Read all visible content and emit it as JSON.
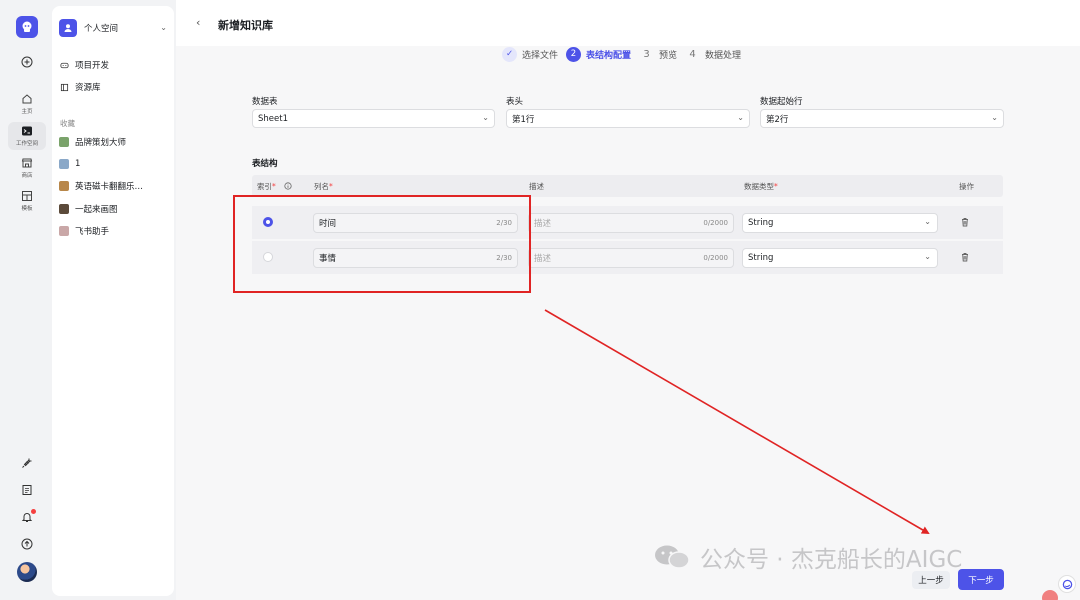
{
  "sidebar": {
    "rail": [
      {
        "label": "主页",
        "icon": "home-icon"
      },
      {
        "label": "工作空间",
        "icon": "terminal-icon"
      },
      {
        "label": "商店",
        "icon": "store-icon"
      },
      {
        "label": "模板",
        "icon": "template-icon"
      }
    ],
    "space_name": "个人空间",
    "items": [
      {
        "label": "项目开发",
        "icon": "gamepad-icon"
      },
      {
        "label": "资源库",
        "icon": "library-icon"
      }
    ],
    "favorites_title": "收藏",
    "favorites": [
      {
        "label": "品牌策划大师",
        "color": "#7aa36b"
      },
      {
        "label": "1",
        "color": "#8aa8c8"
      },
      {
        "label": "英语磁卡翻翻乐…",
        "color": "#b8874a"
      },
      {
        "label": "一起来画图",
        "color": "#5b4a3a"
      },
      {
        "label": "飞书助手",
        "color": "#c9a7a7"
      }
    ]
  },
  "header": {
    "back": "‹",
    "title": "新增知识库"
  },
  "steps": [
    {
      "num": "✓",
      "label": "选择文件",
      "state": "done"
    },
    {
      "num": "2",
      "label": "表结构配置",
      "state": "current"
    },
    {
      "num": "3",
      "label": "预览",
      "state": "todo"
    },
    {
      "num": "4",
      "label": "数据处理",
      "state": "todo"
    }
  ],
  "form": {
    "sheet_label": "数据表",
    "sheet_value": "Sheet1",
    "header_label": "表头",
    "header_value": "第1行",
    "start_label": "数据起始行",
    "start_value": "第2行"
  },
  "table": {
    "title": "表结构",
    "headers": {
      "index": "索引",
      "name": "列名",
      "desc": "描述",
      "type": "数据类型",
      "ops": "操作"
    },
    "rows": [
      {
        "name": "时间",
        "name_count": "2/30",
        "desc_placeholder": "描述",
        "desc_count": "0/2000",
        "type": "String",
        "selected": true
      },
      {
        "name": "事情",
        "name_count": "2/30",
        "desc_placeholder": "描述",
        "desc_count": "0/2000",
        "type": "String",
        "selected": false
      }
    ]
  },
  "footer": {
    "prev": "上一步",
    "next": "下一步"
  },
  "watermark": "公众号 · 杰克船长的AIGC",
  "colors": {
    "accent": "#4d53e8",
    "annotation": "#e02424"
  }
}
